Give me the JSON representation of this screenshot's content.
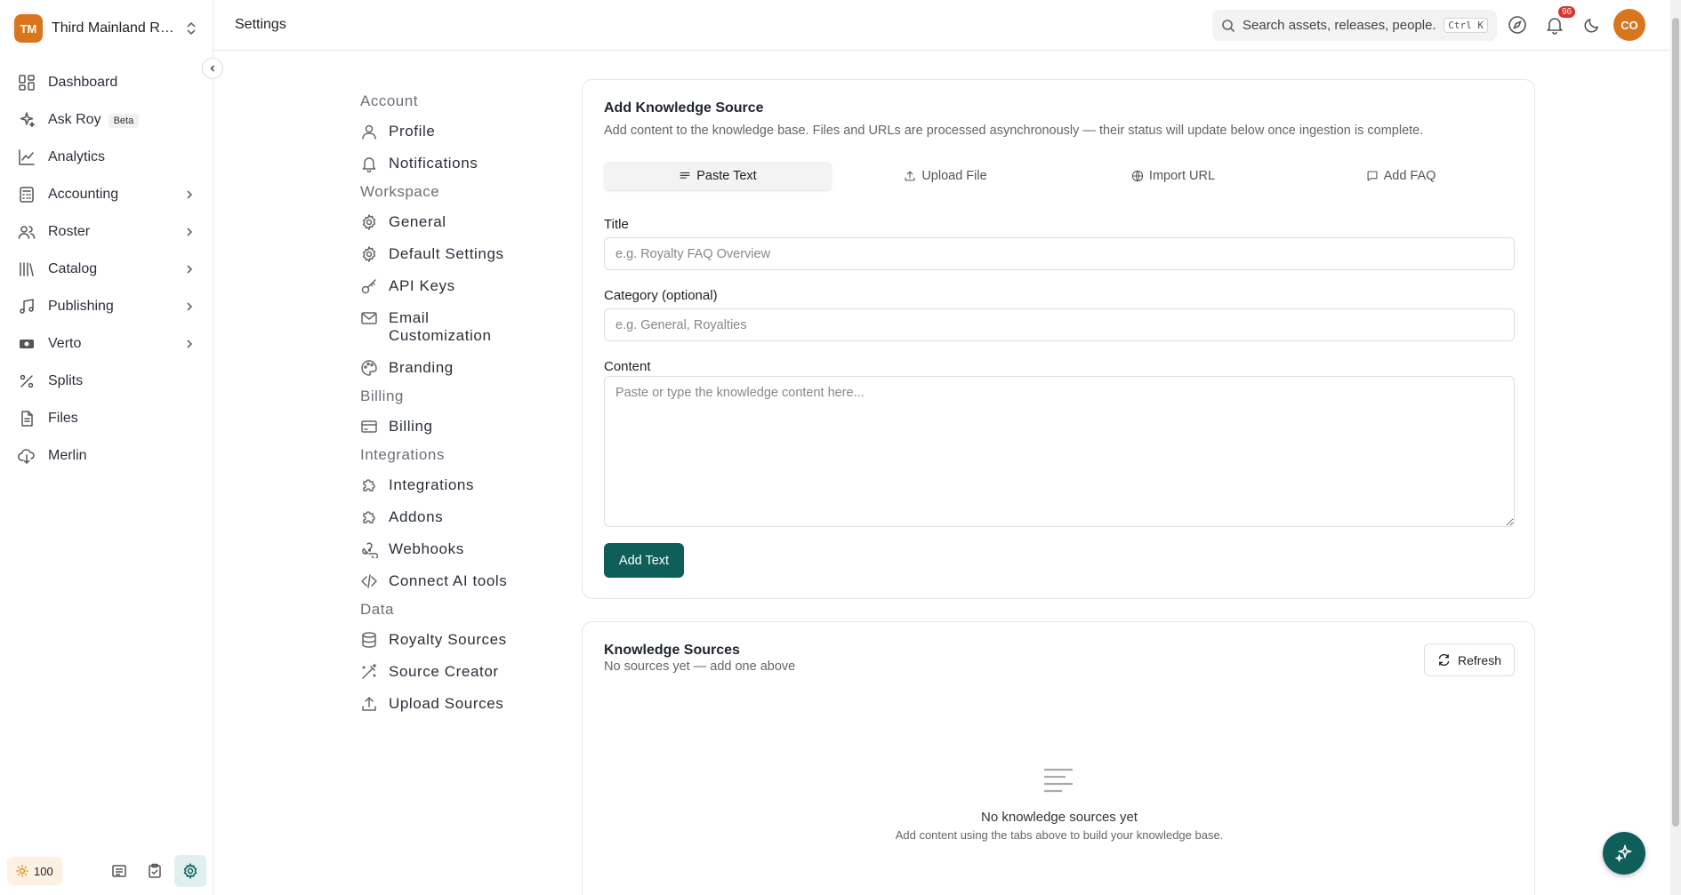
{
  "org": {
    "initials": "TM",
    "name": "Third Mainland Rec..."
  },
  "sidebar": {
    "items": [
      {
        "label": "Dashboard",
        "icon": "dashboard-icon",
        "chevron": false
      },
      {
        "label": "Ask Roy",
        "icon": "sparkle-icon",
        "chevron": false,
        "badge": "Beta"
      },
      {
        "label": "Analytics",
        "icon": "line-chart-icon",
        "chevron": false
      },
      {
        "label": "Accounting",
        "icon": "calculator-icon",
        "chevron": true
      },
      {
        "label": "Roster",
        "icon": "users-icon",
        "chevron": true
      },
      {
        "label": "Catalog",
        "icon": "library-icon",
        "chevron": true
      },
      {
        "label": "Publishing",
        "icon": "music-icon",
        "chevron": true
      },
      {
        "label": "Verto",
        "icon": "verto-icon",
        "chevron": true
      },
      {
        "label": "Splits",
        "icon": "percent-icon",
        "chevron": false
      },
      {
        "label": "Files",
        "icon": "file-icon",
        "chevron": false
      },
      {
        "label": "Merlin",
        "icon": "cloud-download-icon",
        "chevron": false
      }
    ],
    "credits": "100"
  },
  "header": {
    "title": "Settings",
    "search_placeholder": "Search assets, releases, people...",
    "shortcut": "Ctrl K",
    "notification_count": "96",
    "avatar": "CO"
  },
  "settings_nav": [
    {
      "group": "Account",
      "items": [
        {
          "label": "Profile",
          "icon": "user-icon"
        },
        {
          "label": "Notifications",
          "icon": "bell-icon"
        }
      ]
    },
    {
      "group": "Workspace",
      "items": [
        {
          "label": "General",
          "icon": "gear-icon"
        },
        {
          "label": "Default Settings",
          "icon": "gear-icon"
        },
        {
          "label": "API Keys",
          "icon": "key-icon"
        },
        {
          "label": "Email Customization",
          "icon": "mail-icon"
        },
        {
          "label": "Branding",
          "icon": "palette-icon"
        }
      ]
    },
    {
      "group": "Billing",
      "items": [
        {
          "label": "Billing",
          "icon": "credit-card-icon"
        }
      ]
    },
    {
      "group": "Integrations",
      "items": [
        {
          "label": "Integrations",
          "icon": "puzzle-icon"
        },
        {
          "label": "Addons",
          "icon": "puzzle-icon"
        },
        {
          "label": "Webhooks",
          "icon": "webhook-icon"
        },
        {
          "label": "Connect AI tools",
          "icon": "code-icon"
        }
      ]
    },
    {
      "group": "Data",
      "items": [
        {
          "label": "Royalty Sources",
          "icon": "database-icon"
        },
        {
          "label": "Source Creator",
          "icon": "wand-icon"
        },
        {
          "label": "Upload Sources",
          "icon": "upload-icon"
        }
      ]
    }
  ],
  "add_source": {
    "title": "Add Knowledge Source",
    "subtitle": "Add content to the knowledge base. Files and URLs are processed asynchronously — their status will update below once ingestion is complete.",
    "tabs": [
      {
        "label": "Paste Text",
        "icon": "text-icon",
        "active": true
      },
      {
        "label": "Upload File",
        "icon": "upload-icon",
        "active": false
      },
      {
        "label": "Import URL",
        "icon": "globe-icon",
        "active": false
      },
      {
        "label": "Add FAQ",
        "icon": "message-icon",
        "active": false
      }
    ],
    "title_label": "Title",
    "title_placeholder": "e.g. Royalty FAQ Overview",
    "category_label": "Category (optional)",
    "category_placeholder": "e.g. General, Royalties",
    "content_label": "Content",
    "content_placeholder": "Paste or type the knowledge content here...",
    "submit_label": "Add Text"
  },
  "sources": {
    "title": "Knowledge Sources",
    "subtitle": "No sources yet — add one above",
    "refresh_label": "Refresh",
    "empty_title": "No knowledge sources yet",
    "empty_subtitle": "Add content using the tabs above to build your knowledge base."
  }
}
